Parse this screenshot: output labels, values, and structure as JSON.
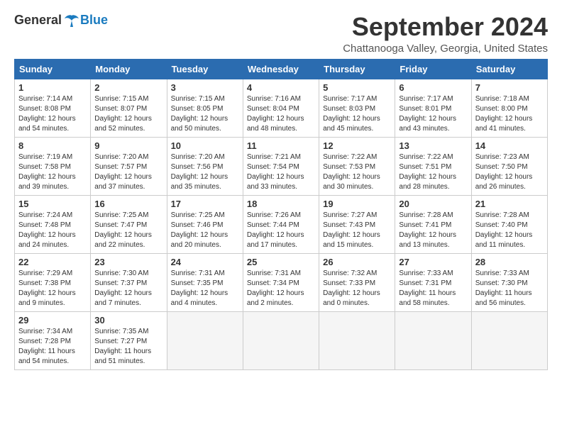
{
  "logo": {
    "general": "General",
    "blue": "Blue"
  },
  "header": {
    "month": "September 2024",
    "location": "Chattanooga Valley, Georgia, United States"
  },
  "weekdays": [
    "Sunday",
    "Monday",
    "Tuesday",
    "Wednesday",
    "Thursday",
    "Friday",
    "Saturday"
  ],
  "weeks": [
    [
      {
        "day": "1",
        "sunrise": "Sunrise: 7:14 AM",
        "sunset": "Sunset: 8:08 PM",
        "daylight": "Daylight: 12 hours and 54 minutes."
      },
      {
        "day": "2",
        "sunrise": "Sunrise: 7:15 AM",
        "sunset": "Sunset: 8:07 PM",
        "daylight": "Daylight: 12 hours and 52 minutes."
      },
      {
        "day": "3",
        "sunrise": "Sunrise: 7:15 AM",
        "sunset": "Sunset: 8:05 PM",
        "daylight": "Daylight: 12 hours and 50 minutes."
      },
      {
        "day": "4",
        "sunrise": "Sunrise: 7:16 AM",
        "sunset": "Sunset: 8:04 PM",
        "daylight": "Daylight: 12 hours and 48 minutes."
      },
      {
        "day": "5",
        "sunrise": "Sunrise: 7:17 AM",
        "sunset": "Sunset: 8:03 PM",
        "daylight": "Daylight: 12 hours and 45 minutes."
      },
      {
        "day": "6",
        "sunrise": "Sunrise: 7:17 AM",
        "sunset": "Sunset: 8:01 PM",
        "daylight": "Daylight: 12 hours and 43 minutes."
      },
      {
        "day": "7",
        "sunrise": "Sunrise: 7:18 AM",
        "sunset": "Sunset: 8:00 PM",
        "daylight": "Daylight: 12 hours and 41 minutes."
      }
    ],
    [
      {
        "day": "8",
        "sunrise": "Sunrise: 7:19 AM",
        "sunset": "Sunset: 7:58 PM",
        "daylight": "Daylight: 12 hours and 39 minutes."
      },
      {
        "day": "9",
        "sunrise": "Sunrise: 7:20 AM",
        "sunset": "Sunset: 7:57 PM",
        "daylight": "Daylight: 12 hours and 37 minutes."
      },
      {
        "day": "10",
        "sunrise": "Sunrise: 7:20 AM",
        "sunset": "Sunset: 7:56 PM",
        "daylight": "Daylight: 12 hours and 35 minutes."
      },
      {
        "day": "11",
        "sunrise": "Sunrise: 7:21 AM",
        "sunset": "Sunset: 7:54 PM",
        "daylight": "Daylight: 12 hours and 33 minutes."
      },
      {
        "day": "12",
        "sunrise": "Sunrise: 7:22 AM",
        "sunset": "Sunset: 7:53 PM",
        "daylight": "Daylight: 12 hours and 30 minutes."
      },
      {
        "day": "13",
        "sunrise": "Sunrise: 7:22 AM",
        "sunset": "Sunset: 7:51 PM",
        "daylight": "Daylight: 12 hours and 28 minutes."
      },
      {
        "day": "14",
        "sunrise": "Sunrise: 7:23 AM",
        "sunset": "Sunset: 7:50 PM",
        "daylight": "Daylight: 12 hours and 26 minutes."
      }
    ],
    [
      {
        "day": "15",
        "sunrise": "Sunrise: 7:24 AM",
        "sunset": "Sunset: 7:48 PM",
        "daylight": "Daylight: 12 hours and 24 minutes."
      },
      {
        "day": "16",
        "sunrise": "Sunrise: 7:25 AM",
        "sunset": "Sunset: 7:47 PM",
        "daylight": "Daylight: 12 hours and 22 minutes."
      },
      {
        "day": "17",
        "sunrise": "Sunrise: 7:25 AM",
        "sunset": "Sunset: 7:46 PM",
        "daylight": "Daylight: 12 hours and 20 minutes."
      },
      {
        "day": "18",
        "sunrise": "Sunrise: 7:26 AM",
        "sunset": "Sunset: 7:44 PM",
        "daylight": "Daylight: 12 hours and 17 minutes."
      },
      {
        "day": "19",
        "sunrise": "Sunrise: 7:27 AM",
        "sunset": "Sunset: 7:43 PM",
        "daylight": "Daylight: 12 hours and 15 minutes."
      },
      {
        "day": "20",
        "sunrise": "Sunrise: 7:28 AM",
        "sunset": "Sunset: 7:41 PM",
        "daylight": "Daylight: 12 hours and 13 minutes."
      },
      {
        "day": "21",
        "sunrise": "Sunrise: 7:28 AM",
        "sunset": "Sunset: 7:40 PM",
        "daylight": "Daylight: 12 hours and 11 minutes."
      }
    ],
    [
      {
        "day": "22",
        "sunrise": "Sunrise: 7:29 AM",
        "sunset": "Sunset: 7:38 PM",
        "daylight": "Daylight: 12 hours and 9 minutes."
      },
      {
        "day": "23",
        "sunrise": "Sunrise: 7:30 AM",
        "sunset": "Sunset: 7:37 PM",
        "daylight": "Daylight: 12 hours and 7 minutes."
      },
      {
        "day": "24",
        "sunrise": "Sunrise: 7:31 AM",
        "sunset": "Sunset: 7:35 PM",
        "daylight": "Daylight: 12 hours and 4 minutes."
      },
      {
        "day": "25",
        "sunrise": "Sunrise: 7:31 AM",
        "sunset": "Sunset: 7:34 PM",
        "daylight": "Daylight: 12 hours and 2 minutes."
      },
      {
        "day": "26",
        "sunrise": "Sunrise: 7:32 AM",
        "sunset": "Sunset: 7:33 PM",
        "daylight": "Daylight: 12 hours and 0 minutes."
      },
      {
        "day": "27",
        "sunrise": "Sunrise: 7:33 AM",
        "sunset": "Sunset: 7:31 PM",
        "daylight": "Daylight: 11 hours and 58 minutes."
      },
      {
        "day": "28",
        "sunrise": "Sunrise: 7:33 AM",
        "sunset": "Sunset: 7:30 PM",
        "daylight": "Daylight: 11 hours and 56 minutes."
      }
    ],
    [
      {
        "day": "29",
        "sunrise": "Sunrise: 7:34 AM",
        "sunset": "Sunset: 7:28 PM",
        "daylight": "Daylight: 11 hours and 54 minutes."
      },
      {
        "day": "30",
        "sunrise": "Sunrise: 7:35 AM",
        "sunset": "Sunset: 7:27 PM",
        "daylight": "Daylight: 11 hours and 51 minutes."
      },
      null,
      null,
      null,
      null,
      null
    ]
  ]
}
